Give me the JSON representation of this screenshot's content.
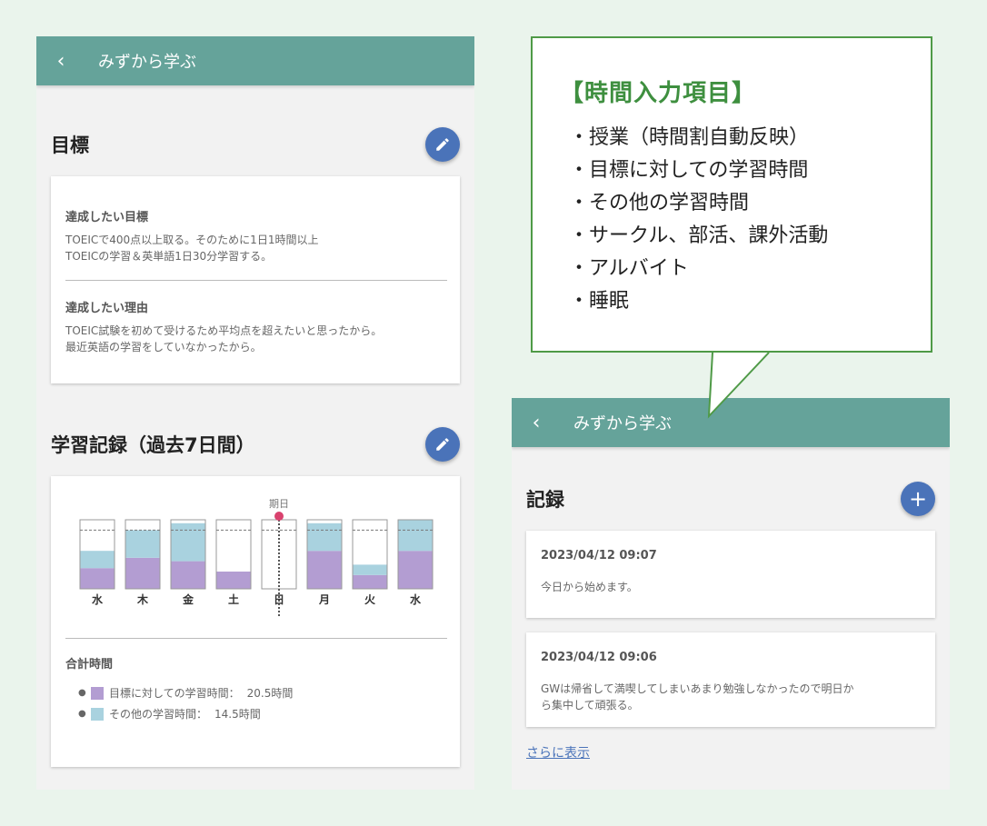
{
  "app": {
    "title": "みずから学ぶ",
    "back_glyph": "‹"
  },
  "goal": {
    "section_title": "目標",
    "items": [
      {
        "label": "達成したい目標",
        "lines": [
          "TOEICで400点以上取る。そのために1日1時間以上",
          "TOEICの学習＆英単語1日30分学習する。"
        ]
      },
      {
        "label": "達成したい理由",
        "lines": [
          "TOEIC試験を初めて受けるため平均点を超えたいと思ったから。",
          "最近英語の学習をしていなかったから。"
        ]
      }
    ]
  },
  "study_log": {
    "section_title": "学習記録（過去7日間）",
    "deadline_label": "期日",
    "total_label": "合計時間",
    "legend": [
      {
        "label": "目標に対しての学習時間：",
        "value": "20.5時間"
      },
      {
        "label": "その他の学習時間：",
        "value": "14.5時間"
      }
    ]
  },
  "chart_data": {
    "type": "bar",
    "categories": [
      "水",
      "木",
      "金",
      "土",
      "日",
      "月",
      "火",
      "水"
    ],
    "series": [
      {
        "values": [
          0.3,
          0.45,
          0.4,
          0.25,
          0.0,
          0.55,
          0.2,
          0.55
        ]
      },
      {
        "values": [
          0.25,
          0.4,
          0.55,
          0.0,
          0.0,
          0.4,
          0.15,
          0.45
        ]
      }
    ],
    "ylim": [
      0,
      1
    ],
    "target_line": 0.85,
    "deadline_index": 4.5,
    "stacked": true,
    "grid": false,
    "colors": {
      "goal": "#b39dd2",
      "other": "#a9d2df",
      "frame": "#999999",
      "target_line": "#777777",
      "deadline": "#d9426e"
    }
  },
  "records": {
    "section_title": "記録",
    "add_glyph": "+",
    "items": [
      {
        "date": "2023/04/12 09:07",
        "lines": [
          "今日から始めます。"
        ]
      },
      {
        "date": "2023/04/12 09:06",
        "lines": [
          "GWは帰省して満喫してしまいあまり勉強しなかったので明日か",
          "ら集中して頑張る。"
        ]
      }
    ],
    "more_link": "さらに表示"
  },
  "callout": {
    "title": "【時間入力項目】",
    "bullet": "・",
    "items": [
      "授業（時間割自動反映）",
      "目標に対しての学習時間",
      "その他の学習時間",
      "サークル、部活、課外活動",
      "アルバイト",
      "睡眠"
    ]
  },
  "colors": {
    "appbar": "#65a39a",
    "fab": "#4a73b9",
    "callout_border": "#4f9a47",
    "callout_title": "#3e8f3f",
    "background": "#eaf4ec"
  }
}
